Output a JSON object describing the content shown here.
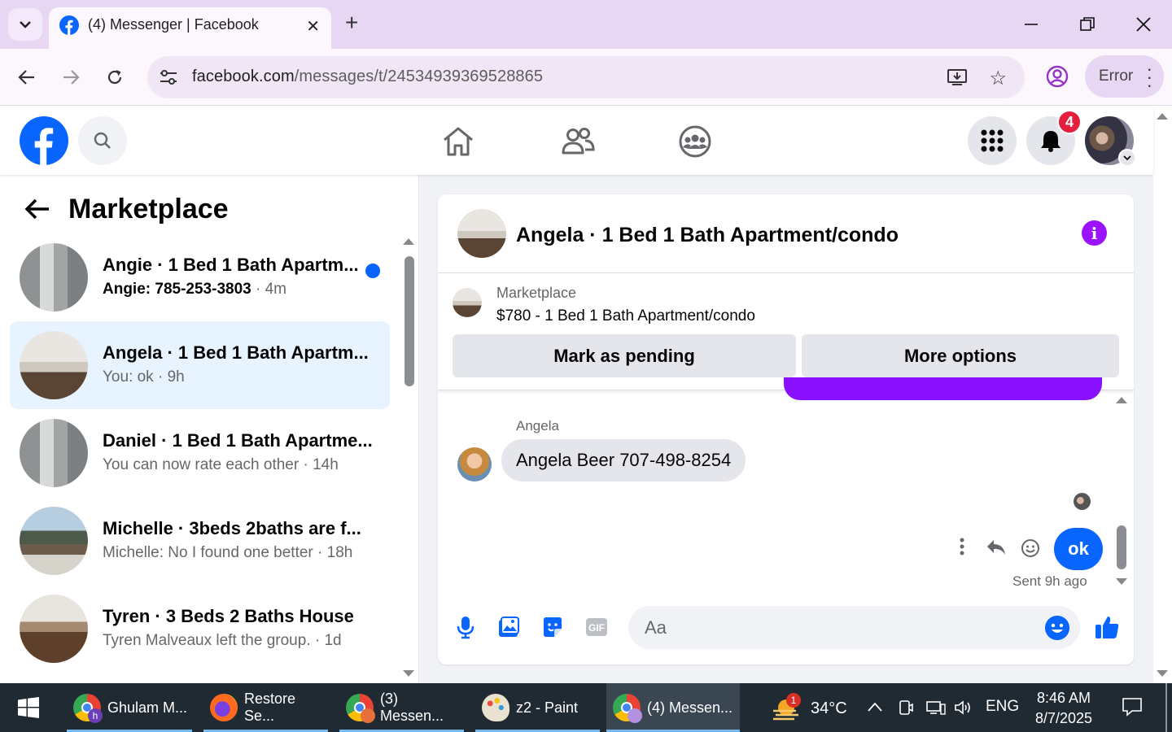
{
  "browser": {
    "tab_title": "(4) Messenger | Facebook",
    "url_domain": "facebook.com",
    "url_path": "/messages/t/24534939369528865",
    "error_label": "Error"
  },
  "header": {
    "notification_count": "4"
  },
  "sidebar": {
    "title": "Marketplace",
    "conversations": [
      {
        "name": "Angie · 1 Bed 1 Bath Apartm...",
        "preview": "Angie: 785-253-3803",
        "time": "· 4m",
        "unread": true
      },
      {
        "name": "Angela · 1 Bed 1 Bath Apartm...",
        "preview": "You: ok",
        "time": "· 9h",
        "active": true
      },
      {
        "name": "Daniel · 1 Bed 1 Bath Apartme...",
        "preview": "You can now rate each other",
        "time": "· 14h"
      },
      {
        "name": "Michelle · 3beds 2baths are f...",
        "preview": "Michelle: No I found one better",
        "time": "· 18h"
      },
      {
        "name": "Tyren · 3 Beds 2 Baths House",
        "preview": "Tyren Malveaux left the group.",
        "time": "· 1d"
      }
    ]
  },
  "chat": {
    "title": "Angela · 1 Bed 1 Bath Apartment/condo",
    "listing_source": "Marketplace",
    "listing_title": "$780 - 1 Bed 1 Bath Apartment/condo",
    "mark_pending_label": "Mark as pending",
    "more_options_label": "More options",
    "sender_name": "Angela",
    "incoming_message": "Angela Beer 707-498-8254",
    "outgoing_message": "ok",
    "sent_status": "Sent 9h ago",
    "composer_placeholder": "Aa"
  },
  "taskbar": {
    "items": [
      {
        "label": "Ghulam M..."
      },
      {
        "label": "Restore Se..."
      },
      {
        "label": "(3) Messen..."
      },
      {
        "label": "z2 - Paint"
      },
      {
        "label": "(4) Messen..."
      }
    ],
    "weather_badge": "1",
    "temperature": "34°C",
    "language": "ENG",
    "time": "8:46 AM",
    "date": "8/7/2025"
  },
  "colors": {
    "fb_blue": "#0866ff",
    "messenger_purple": "#9b12ff",
    "notification_red": "#e41e3f",
    "chrome_tab_bg": "#e8d7f3"
  }
}
